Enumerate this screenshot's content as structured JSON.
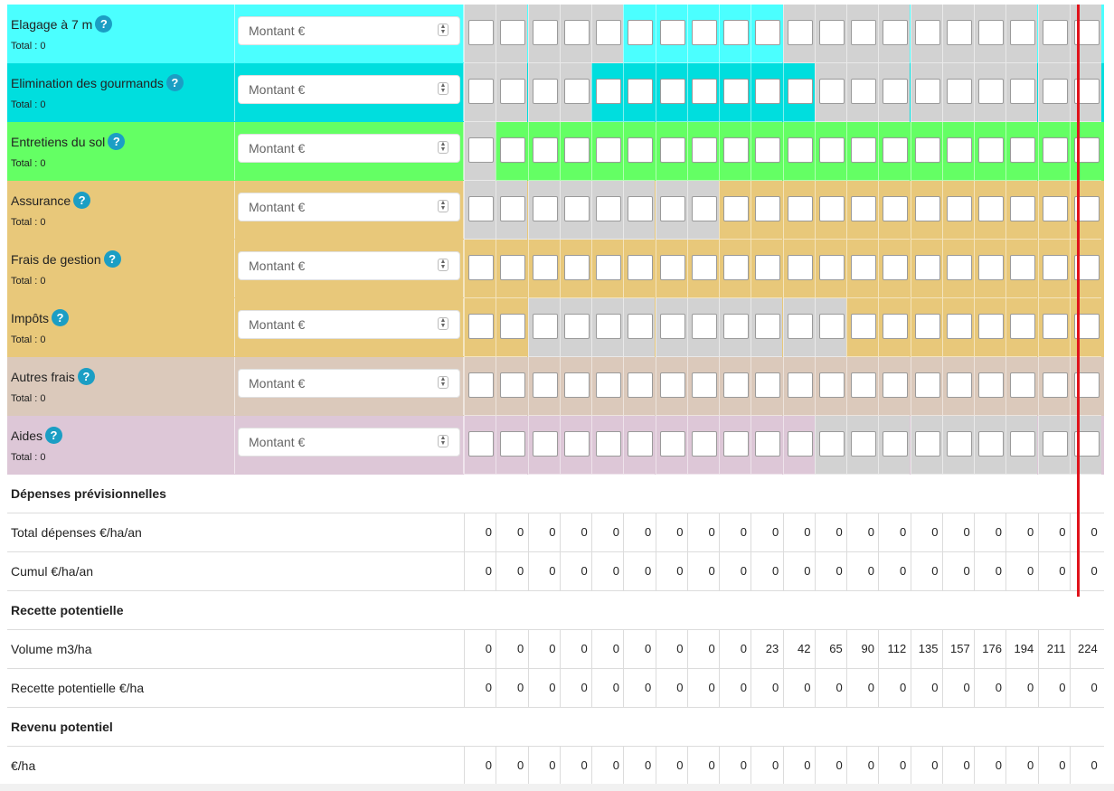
{
  "colors": {
    "cyan": "#4bffff",
    "teal": "#00dede",
    "green": "#64ff64",
    "tan": "#e8c87a",
    "beige": "#dbc9bb",
    "pink": "#ddc7d7",
    "grey": "#d2d2d2",
    "marker_line": "#e0131b",
    "help_badge": "#1b9ec4"
  },
  "cost_rows": [
    {
      "label": "Elagage à 7 m",
      "total": "Total : 0",
      "placeholder": "Montant €",
      "color": "cyan",
      "active_ranges": [
        [
          5,
          9
        ]
      ]
    },
    {
      "label": "Elimination des gourmands",
      "total": "Total : 0",
      "placeholder": "Montant €",
      "color": "teal",
      "active_ranges": [
        [
          4,
          10
        ]
      ]
    },
    {
      "label": "Entretiens du sol",
      "total": "Total : 0",
      "placeholder": "Montant €",
      "color": "green",
      "active_ranges": [
        [
          1,
          19
        ]
      ]
    },
    {
      "label": "Assurance",
      "total": "Total : 0",
      "placeholder": "Montant €",
      "color": "tan",
      "active_ranges": [
        [
          8,
          19
        ]
      ]
    },
    {
      "label": "Frais de gestion",
      "total": "Total : 0",
      "placeholder": "Montant €",
      "color": "tan",
      "active_ranges": [
        [
          0,
          19
        ]
      ]
    },
    {
      "label": "Impôts",
      "total": "Total : 0",
      "placeholder": "Montant €",
      "color": "tan",
      "active_ranges": [
        [
          0,
          1
        ],
        [
          12,
          19
        ]
      ]
    },
    {
      "label": "Autres frais",
      "total": "Total : 0",
      "placeholder": "Montant €",
      "color": "beige",
      "active_ranges": [
        [
          0,
          19
        ]
      ]
    },
    {
      "label": "Aides",
      "total": "Total : 0",
      "placeholder": "Montant €",
      "color": "pink",
      "active_ranges": [
        [
          0,
          10
        ]
      ]
    }
  ],
  "help_icon_text": "?",
  "table_rows": [
    {
      "type": "section",
      "label": "Dépenses prévisionnelles"
    },
    {
      "type": "data",
      "label": "Total dépenses €/ha/an",
      "values": [
        "0",
        "0",
        "0",
        "0",
        "0",
        "0",
        "0",
        "0",
        "0",
        "0",
        "0",
        "0",
        "0",
        "0",
        "0",
        "0",
        "0",
        "0",
        "0",
        "0"
      ]
    },
    {
      "type": "data",
      "label": "Cumul €/ha/an",
      "values": [
        "0",
        "0",
        "0",
        "0",
        "0",
        "0",
        "0",
        "0",
        "0",
        "0",
        "0",
        "0",
        "0",
        "0",
        "0",
        "0",
        "0",
        "0",
        "0",
        "0"
      ]
    },
    {
      "type": "section",
      "label": "Recette potentielle"
    },
    {
      "type": "data",
      "label": "Volume m3/ha",
      "values": [
        "0",
        "0",
        "0",
        "0",
        "0",
        "0",
        "0",
        "0",
        "0",
        "23",
        "42",
        "65",
        "90",
        "112",
        "135",
        "157",
        "176",
        "194",
        "211",
        "224"
      ]
    },
    {
      "type": "data",
      "label": "Recette potentielle €/ha",
      "values": [
        "0",
        "0",
        "0",
        "0",
        "0",
        "0",
        "0",
        "0",
        "0",
        "0",
        "0",
        "0",
        "0",
        "0",
        "0",
        "0",
        "0",
        "0",
        "0",
        "0"
      ]
    },
    {
      "type": "section",
      "label": "Revenu potentiel"
    },
    {
      "type": "data",
      "label": "€/ha",
      "values": [
        "0",
        "0",
        "0",
        "0",
        "0",
        "0",
        "0",
        "0",
        "0",
        "0",
        "0",
        "0",
        "0",
        "0",
        "0",
        "0",
        "0",
        "0",
        "0",
        "0"
      ]
    }
  ]
}
